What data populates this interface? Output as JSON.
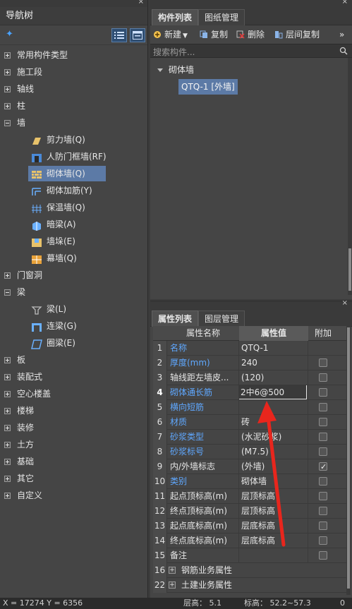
{
  "nav": {
    "title": "导航树",
    "close": "×",
    "items": [
      {
        "label": "常用构件类型",
        "expanded": false
      },
      {
        "label": "施工段",
        "expanded": false
      },
      {
        "label": "轴线",
        "expanded": false
      },
      {
        "label": "柱",
        "expanded": false
      },
      {
        "label": "墙",
        "expanded": true
      },
      {
        "label": "剪力墙(Q)",
        "child": true
      },
      {
        "label": "人防门框墙(RF)",
        "child": true
      },
      {
        "label": "砌体墙(Q)",
        "child": true,
        "selected": true
      },
      {
        "label": "砌体加筋(Y)",
        "child": true
      },
      {
        "label": "保温墙(Q)",
        "child": true
      },
      {
        "label": "暗梁(A)",
        "child": true
      },
      {
        "label": "墙垛(E)",
        "child": true
      },
      {
        "label": "幕墙(Q)",
        "child": true
      },
      {
        "label": "门窗洞",
        "expanded": false
      },
      {
        "label": "梁",
        "expanded": true
      },
      {
        "label": "梁(L)",
        "child": true
      },
      {
        "label": "连梁(G)",
        "child": true
      },
      {
        "label": "圈梁(E)",
        "child": true
      },
      {
        "label": "板",
        "expanded": false
      },
      {
        "label": "装配式",
        "expanded": false
      },
      {
        "label": "空心楼盖",
        "expanded": false
      },
      {
        "label": "楼梯",
        "expanded": false
      },
      {
        "label": "装修",
        "expanded": false
      },
      {
        "label": "土方",
        "expanded": false
      },
      {
        "label": "基础",
        "expanded": false
      },
      {
        "label": "其它",
        "expanded": false
      },
      {
        "label": "自定义",
        "expanded": false
      }
    ]
  },
  "components": {
    "tabs": [
      "构件列表",
      "图纸管理"
    ],
    "toolbar": {
      "new": "新建",
      "copy": "复制",
      "delete": "删除",
      "floor_copy": "层间复制",
      "more": "»"
    },
    "search_placeholder": "搜索构件...",
    "group": "砌体墙",
    "item": "QTQ-1 [外墙]"
  },
  "properties": {
    "tabs": [
      "属性列表",
      "图层管理"
    ],
    "headers": {
      "name": "属性名称",
      "value": "属性值",
      "extra": "附加"
    },
    "rows": [
      {
        "num": "1",
        "name": "名称",
        "value": "QTQ-1",
        "blue": true,
        "cb": false,
        "has_cb": false
      },
      {
        "num": "2",
        "name": "厚度(mm)",
        "value": "240",
        "blue": true,
        "cb": false,
        "has_cb": true
      },
      {
        "num": "3",
        "name": "轴线距左墙皮...",
        "value": "(120)",
        "blue": false,
        "cb": false,
        "has_cb": true
      },
      {
        "num": "4",
        "name": "砌体通长筋",
        "value": "2中6@500",
        "blue": true,
        "cb": false,
        "has_cb": true,
        "editing": true
      },
      {
        "num": "5",
        "name": "横向短筋",
        "value": "",
        "blue": true,
        "cb": false,
        "has_cb": true
      },
      {
        "num": "6",
        "name": "材质",
        "value": "砖",
        "blue": true,
        "cb": false,
        "has_cb": true
      },
      {
        "num": "7",
        "name": "砂浆类型",
        "value": "(水泥砂浆)",
        "blue": true,
        "cb": false,
        "has_cb": true
      },
      {
        "num": "8",
        "name": "砂浆标号",
        "value": "(M7.5)",
        "blue": true,
        "cb": false,
        "has_cb": true
      },
      {
        "num": "9",
        "name": "内/外墙标志",
        "value": "(外墙)",
        "blue": false,
        "cb": true,
        "has_cb": true
      },
      {
        "num": "10",
        "name": "类别",
        "value": "砌体墙",
        "blue": true,
        "cb": false,
        "has_cb": true
      },
      {
        "num": "11",
        "name": "起点顶标高(m)",
        "value": "层顶标高",
        "blue": false,
        "cb": false,
        "has_cb": true
      },
      {
        "num": "12",
        "name": "终点顶标高(m)",
        "value": "层顶标高",
        "blue": false,
        "cb": false,
        "has_cb": true
      },
      {
        "num": "13",
        "name": "起点底标高(m)",
        "value": "层底标高",
        "blue": false,
        "cb": false,
        "has_cb": true
      },
      {
        "num": "14",
        "name": "终点底标高(m)",
        "value": "层底标高",
        "blue": false,
        "cb": false,
        "has_cb": true
      },
      {
        "num": "15",
        "name": "备注",
        "value": "",
        "blue": false,
        "cb": false,
        "has_cb": true
      },
      {
        "num": "16",
        "name": "钢筋业务属性",
        "value": "",
        "blue": false,
        "cb": false,
        "has_cb": false,
        "group": true
      },
      {
        "num": "22",
        "name": "土建业务属性",
        "value": "",
        "blue": false,
        "cb": false,
        "has_cb": false,
        "group": true
      }
    ]
  },
  "status": {
    "coords": "X = 17274 Y = 6356",
    "floor_height": "层高：   5.1",
    "elevation": "标高：  52.2~57.3",
    "zero": "0"
  },
  "colors": {
    "accent": "#5c7aa6",
    "link_blue": "#5fa8ff",
    "annotation": "#e8261d"
  }
}
